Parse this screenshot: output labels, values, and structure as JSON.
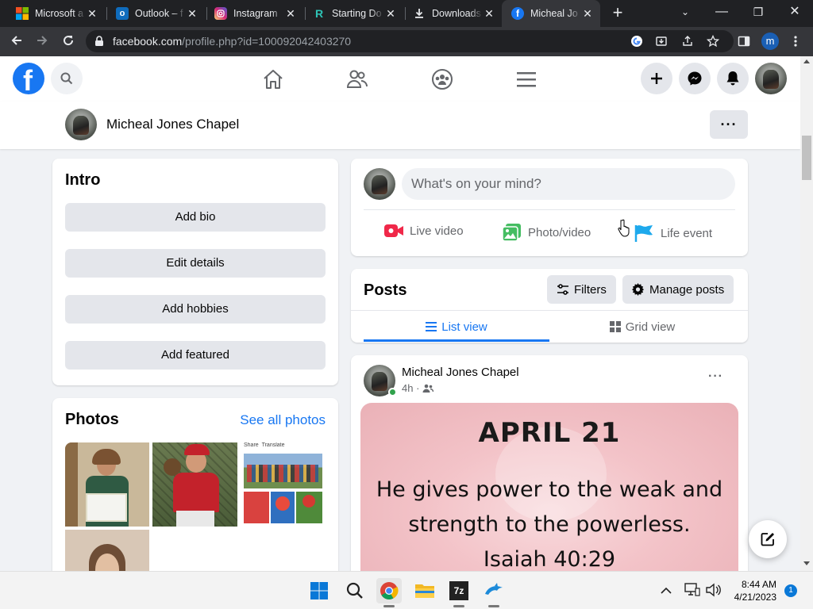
{
  "browser": {
    "tabs": [
      {
        "title": "Microsoft a",
        "icon": "microsoft-icon"
      },
      {
        "title": "Outlook – f",
        "icon": "outlook-icon"
      },
      {
        "title": "Instagram",
        "icon": "instagram-icon"
      },
      {
        "title": "Starting Do",
        "icon": "replit-icon"
      },
      {
        "title": "Downloads",
        "icon": "download-icon"
      },
      {
        "title": "Micheal Jo",
        "icon": "facebook-icon",
        "active": true
      }
    ],
    "url_domain": "facebook.com",
    "url_path": "/profile.php?id=100092042403270",
    "profile_initial": "m"
  },
  "profile_header": {
    "name": "Micheal Jones Chapel",
    "more_label": "···"
  },
  "intro": {
    "title": "Intro",
    "buttons": [
      "Add bio",
      "Edit details",
      "Add hobbies",
      "Add featured"
    ]
  },
  "photos": {
    "title": "Photos",
    "see_all": "See all photos",
    "thumb3_share": "Share",
    "thumb3_translate": "Translate"
  },
  "composer": {
    "placeholder": "What's on your mind?",
    "actions": [
      "Live video",
      "Photo/video",
      "Life event"
    ]
  },
  "posts": {
    "title": "Posts",
    "filters_label": "Filters",
    "manage_label": "Manage posts",
    "list_view": "List view",
    "grid_view": "Grid view"
  },
  "post": {
    "author": "Micheal Jones Chapel",
    "time": "4h ·",
    "more": "···",
    "image_heading": "APRIL 21",
    "image_line1": "He gives power to the weak and",
    "image_line2": "strength to the powerless.",
    "image_line3": "Isaiah 40:29"
  },
  "taskbar": {
    "time": "8:44 AM",
    "date": "4/21/2023",
    "notification_count": "1"
  },
  "colors": {
    "facebook_blue": "#1877f2",
    "chrome_dark": "#202124",
    "chrome_toolbar": "#35363a",
    "page_bg": "#f0f2f5"
  }
}
